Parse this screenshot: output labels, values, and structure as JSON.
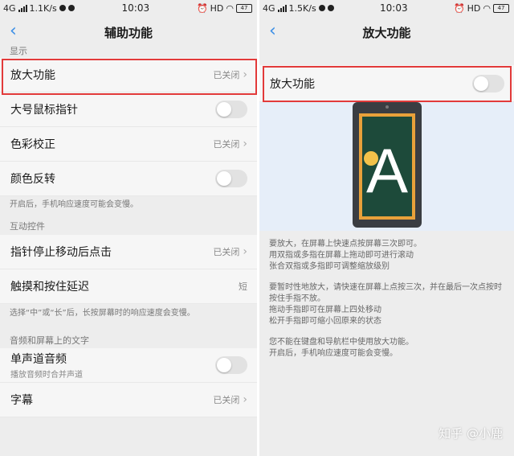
{
  "left": {
    "status": {
      "network": "4G",
      "speed": "1.1K/s",
      "time": "10:03",
      "hd": "HD",
      "battery": "47"
    },
    "nav": {
      "title": "辅助功能"
    },
    "section_display": "显示",
    "rows_display": [
      {
        "label": "放大功能",
        "value": "已关闭",
        "control": "chevron"
      },
      {
        "label": "大号鼠标指针",
        "control": "toggle"
      },
      {
        "label": "色彩校正",
        "value": "已关闭",
        "control": "chevron"
      },
      {
        "label": "颜色反转",
        "control": "toggle"
      }
    ],
    "note_display": "开启后，手机响应速度可能会变慢。",
    "section_interaction": "互动控件",
    "rows_interaction": [
      {
        "label": "指针停止移动后点击",
        "value": "已关闭",
        "control": "chevron"
      },
      {
        "label": "触摸和按住延迟",
        "value": "短"
      }
    ],
    "note_interaction": "选择“中”或“长”后，长按屏幕时的响应速度会变慢。",
    "section_audio": "音频和屏幕上的文字",
    "rows_audio": [
      {
        "label": "单声道音频",
        "sub": "播放音频时合并声道",
        "control": "toggle"
      },
      {
        "label": "字幕",
        "value": "已关闭",
        "control": "chevron"
      }
    ]
  },
  "right": {
    "status": {
      "network": "4G",
      "speed": "1.5K/s",
      "time": "10:03",
      "hd": "HD",
      "battery": "47"
    },
    "nav": {
      "title": "放大功能"
    },
    "switch_label": "放大功能",
    "illustration_letter": "A",
    "desc1": "要放大，在屏幕上快速点按屏幕三次即可。\n用双指或多指在屏幕上拖动即可进行滚动\n张合双指或多指即可调整缩放级别",
    "desc2": "要暂时性地放大，请快速在屏幕上点按三次，并在最后一次点按时按住手指不放。\n拖动手指即可在屏幕上四处移动\n松开手指即可缩小回原来的状态",
    "desc3": "您不能在键盘和导航栏中使用放大功能。\n开启后，手机响应速度可能会变慢。"
  },
  "watermark": "知乎 @小鹿",
  "colors": {
    "accent": "#3a8ee6",
    "highlight": "#e23a3a",
    "phone_screen": "#1d4a3a",
    "phone_border": "#e8a13a"
  }
}
